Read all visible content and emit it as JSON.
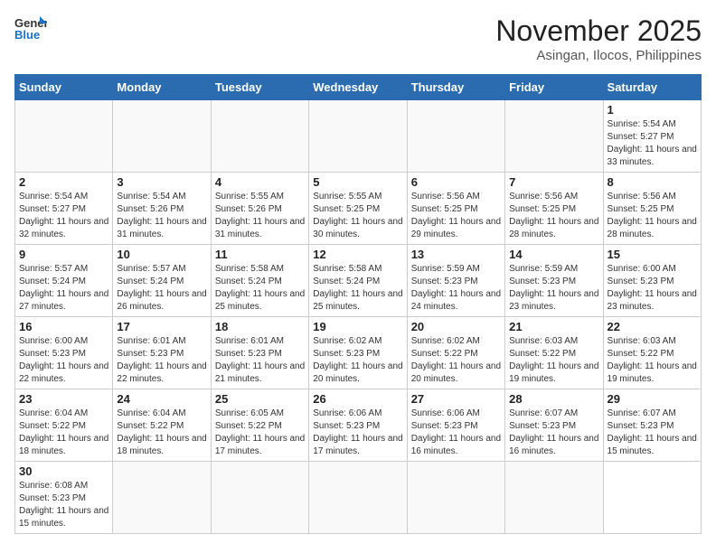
{
  "logo": {
    "general": "General",
    "blue": "Blue"
  },
  "title": {
    "month": "November 2025",
    "location": "Asingan, Ilocos, Philippines"
  },
  "weekdays": [
    "Sunday",
    "Monday",
    "Tuesday",
    "Wednesday",
    "Thursday",
    "Friday",
    "Saturday"
  ],
  "days": [
    {
      "num": "",
      "info": ""
    },
    {
      "num": "",
      "info": ""
    },
    {
      "num": "",
      "info": ""
    },
    {
      "num": "",
      "info": ""
    },
    {
      "num": "",
      "info": ""
    },
    {
      "num": "",
      "info": ""
    },
    {
      "num": "1",
      "info": "Sunrise: 5:54 AM\nSunset: 5:27 PM\nDaylight: 11 hours\nand 33 minutes."
    },
    {
      "num": "2",
      "info": "Sunrise: 5:54 AM\nSunset: 5:27 PM\nDaylight: 11 hours\nand 32 minutes."
    },
    {
      "num": "3",
      "info": "Sunrise: 5:54 AM\nSunset: 5:26 PM\nDaylight: 11 hours\nand 31 minutes."
    },
    {
      "num": "4",
      "info": "Sunrise: 5:55 AM\nSunset: 5:26 PM\nDaylight: 11 hours\nand 31 minutes."
    },
    {
      "num": "5",
      "info": "Sunrise: 5:55 AM\nSunset: 5:25 PM\nDaylight: 11 hours\nand 30 minutes."
    },
    {
      "num": "6",
      "info": "Sunrise: 5:56 AM\nSunset: 5:25 PM\nDaylight: 11 hours\nand 29 minutes."
    },
    {
      "num": "7",
      "info": "Sunrise: 5:56 AM\nSunset: 5:25 PM\nDaylight: 11 hours\nand 28 minutes."
    },
    {
      "num": "8",
      "info": "Sunrise: 5:56 AM\nSunset: 5:25 PM\nDaylight: 11 hours\nand 28 minutes."
    },
    {
      "num": "9",
      "info": "Sunrise: 5:57 AM\nSunset: 5:24 PM\nDaylight: 11 hours\nand 27 minutes."
    },
    {
      "num": "10",
      "info": "Sunrise: 5:57 AM\nSunset: 5:24 PM\nDaylight: 11 hours\nand 26 minutes."
    },
    {
      "num": "11",
      "info": "Sunrise: 5:58 AM\nSunset: 5:24 PM\nDaylight: 11 hours\nand 25 minutes."
    },
    {
      "num": "12",
      "info": "Sunrise: 5:58 AM\nSunset: 5:24 PM\nDaylight: 11 hours\nand 25 minutes."
    },
    {
      "num": "13",
      "info": "Sunrise: 5:59 AM\nSunset: 5:23 PM\nDaylight: 11 hours\nand 24 minutes."
    },
    {
      "num": "14",
      "info": "Sunrise: 5:59 AM\nSunset: 5:23 PM\nDaylight: 11 hours\nand 23 minutes."
    },
    {
      "num": "15",
      "info": "Sunrise: 6:00 AM\nSunset: 5:23 PM\nDaylight: 11 hours\nand 23 minutes."
    },
    {
      "num": "16",
      "info": "Sunrise: 6:00 AM\nSunset: 5:23 PM\nDaylight: 11 hours\nand 22 minutes."
    },
    {
      "num": "17",
      "info": "Sunrise: 6:01 AM\nSunset: 5:23 PM\nDaylight: 11 hours\nand 22 minutes."
    },
    {
      "num": "18",
      "info": "Sunrise: 6:01 AM\nSunset: 5:23 PM\nDaylight: 11 hours\nand 21 minutes."
    },
    {
      "num": "19",
      "info": "Sunrise: 6:02 AM\nSunset: 5:23 PM\nDaylight: 11 hours\nand 20 minutes."
    },
    {
      "num": "20",
      "info": "Sunrise: 6:02 AM\nSunset: 5:22 PM\nDaylight: 11 hours\nand 20 minutes."
    },
    {
      "num": "21",
      "info": "Sunrise: 6:03 AM\nSunset: 5:22 PM\nDaylight: 11 hours\nand 19 minutes."
    },
    {
      "num": "22",
      "info": "Sunrise: 6:03 AM\nSunset: 5:22 PM\nDaylight: 11 hours\nand 19 minutes."
    },
    {
      "num": "23",
      "info": "Sunrise: 6:04 AM\nSunset: 5:22 PM\nDaylight: 11 hours\nand 18 minutes."
    },
    {
      "num": "24",
      "info": "Sunrise: 6:04 AM\nSunset: 5:22 PM\nDaylight: 11 hours\nand 18 minutes."
    },
    {
      "num": "25",
      "info": "Sunrise: 6:05 AM\nSunset: 5:22 PM\nDaylight: 11 hours\nand 17 minutes."
    },
    {
      "num": "26",
      "info": "Sunrise: 6:06 AM\nSunset: 5:23 PM\nDaylight: 11 hours\nand 17 minutes."
    },
    {
      "num": "27",
      "info": "Sunrise: 6:06 AM\nSunset: 5:23 PM\nDaylight: 11 hours\nand 16 minutes."
    },
    {
      "num": "28",
      "info": "Sunrise: 6:07 AM\nSunset: 5:23 PM\nDaylight: 11 hours\nand 16 minutes."
    },
    {
      "num": "29",
      "info": "Sunrise: 6:07 AM\nSunset: 5:23 PM\nDaylight: 11 hours\nand 15 minutes."
    },
    {
      "num": "30",
      "info": "Sunrise: 6:08 AM\nSunset: 5:23 PM\nDaylight: 11 hours\nand 15 minutes."
    },
    {
      "num": "",
      "info": ""
    },
    {
      "num": "",
      "info": ""
    },
    {
      "num": "",
      "info": ""
    },
    {
      "num": "",
      "info": ""
    },
    {
      "num": "",
      "info": ""
    }
  ]
}
